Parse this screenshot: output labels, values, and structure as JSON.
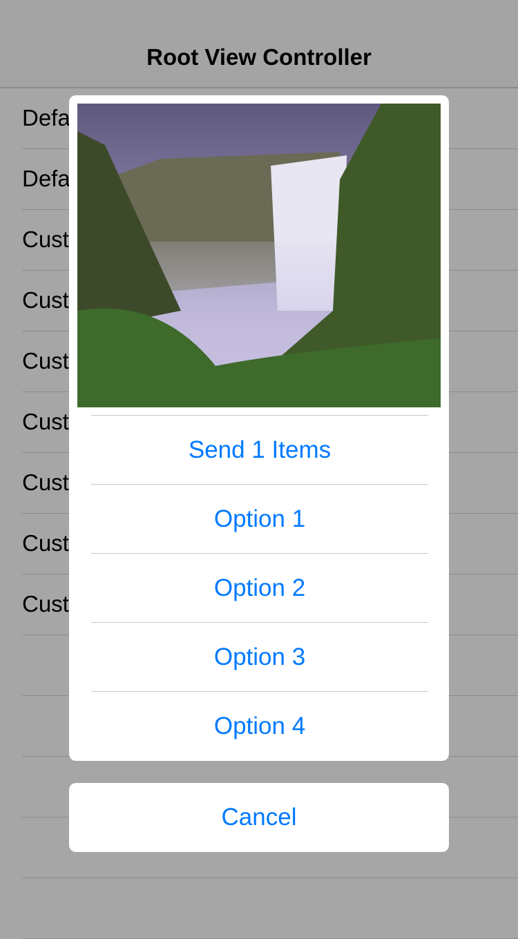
{
  "nav": {
    "title": "Root View Controller"
  },
  "rows": [
    "Defa",
    "Defa",
    "Cust",
    "Cust",
    "Cust",
    "Cust",
    "Cust",
    "Cust",
    "Cust",
    "",
    "",
    "",
    "",
    ""
  ],
  "sheet": {
    "options": [
      "Send 1 Items",
      "Option 1",
      "Option 2",
      "Option 3",
      "Option 4"
    ],
    "cancel": "Cancel"
  },
  "colors": {
    "accent": "#007aff",
    "dim": "#a6a6a6"
  }
}
